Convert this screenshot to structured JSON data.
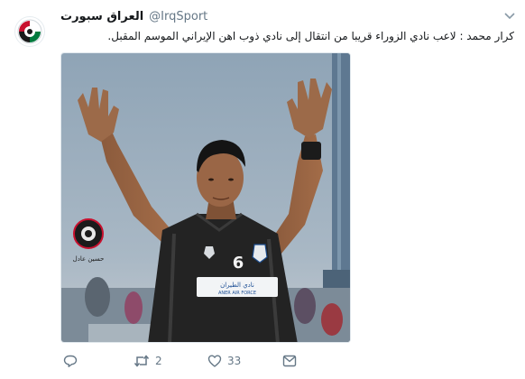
{
  "tweet": {
    "display_name": "العراق سبورت",
    "handle": "@IrqSport",
    "text": "كرار محمد : لاعب نادي الزوراء  قريبا من انتقال إلى نادي ذوب اهن الإيراني الموسم المقبل.",
    "media": {
      "jersey_number": "6",
      "sponsor_text": "نادي الطيران",
      "sponsor_sub": "ANER AIR FORCE",
      "watermark_text": "حسين عادل"
    },
    "actions": {
      "reply_icon": "reply-icon",
      "retweet_icon": "retweet-icon",
      "retweet_count": "2",
      "like_icon": "heart-icon",
      "like_count": "33",
      "dm_icon": "direct-message-icon"
    }
  },
  "colors": {
    "text_primary": "#14171a",
    "text_secondary": "#657786",
    "border": "#e1e8ed"
  }
}
